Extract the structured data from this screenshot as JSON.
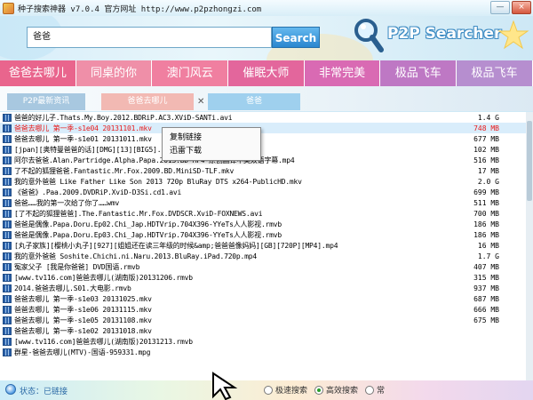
{
  "window": {
    "title": "种子搜索神器  v7.0.4  官方网址  http://www.p2pzhongzi.com",
    "minimize_glyph": "—",
    "close_glyph": "×"
  },
  "search": {
    "query": "爸爸",
    "button_label": "Search"
  },
  "logo": {
    "text": "P2P Searcher"
  },
  "hot_tags": [
    {
      "label": "爸爸去哪儿",
      "color": "#e9658d"
    },
    {
      "label": "同桌的你",
      "color": "#ef8fa8"
    },
    {
      "label": "澳门风云",
      "color": "#f07fa0"
    },
    {
      "label": "催眠大师",
      "color": "#e3669c"
    },
    {
      "label": "非常完美",
      "color": "#d96ab3"
    },
    {
      "label": "极品飞车",
      "color": "#be78c4"
    },
    {
      "label": "极品飞车",
      "color": "#b68ecf"
    }
  ],
  "tabs": [
    {
      "label": "P2P最新资讯",
      "color": "#a8c8e0"
    },
    {
      "label": "爸爸去哪儿",
      "color": "#f2b9b3"
    },
    {
      "label": "爸爸",
      "color": "#9fd0ee"
    }
  ],
  "tab_close_glyph": "✕",
  "files": [
    {
      "name": "爸爸的好儿子.Thats.My.Boy.2012.BDRiP.AC3.XViD-SANTi.avi",
      "size": "1.4 G"
    },
    {
      "name": "爸爸去哪儿 第一季-s1e04 20131101.mkv",
      "size": "748 MB"
    },
    {
      "name": "爸爸去哪儿 第一季-s1e01 20131011.mkv",
      "size": "677 MB"
    },
    {
      "name": "[jpan][奥特曼爸爸的话][DMG][13][BIG5].rmvb",
      "size": "102 MB"
    },
    {
      "name": "阿尔去爸爸.Alan.Partridge.Alpha.Papa.2013.BD-MP4-原创翻译中英双语字幕.mp4",
      "size": "516 MB"
    },
    {
      "name": "了不起的狐狸爸爸.Fantastic.Mr.Fox.2009.BD.MiniSD-TLF.mkv",
      "size": "17 MB"
    },
    {
      "name": "我的意外爸爸 Like Father Like Son 2013 720p BluRay DTS x264-PublicHD.mkv",
      "size": "2.0 G"
    },
    {
      "name": "《爸爸》.Paa.2009.DVDRiP.XviD-D3Si.cd1.avi",
      "size": "699 MB"
    },
    {
      "name": "爸爸……我的第一次给了你了……wmv",
      "size": "511 MB"
    },
    {
      "name": "[了不起的狐狸爸爸].The.Fantastic.Mr.Fox.DVDSCR.XviD-FOXNEWS.avi",
      "size": "700 MB"
    },
    {
      "name": "爸爸是偶像.Papa.Doru.Ep02.Chi_Jap.HDTVrip.704X396-YYeTs人人影视.rmvb",
      "size": "186 MB"
    },
    {
      "name": "爸爸是偶像.Papa.Doru.Ep03.Chi_Jap.HDTVrip.704X396-YYeTs人人影视.rmvb",
      "size": "186 MB"
    },
    {
      "name": "[丸子家族][樱桃小丸子][927][姐姐还在读三年级的时候&amp;爸爸爸像妈妈][GB][720P][MP4].mp4",
      "size": "16 MB"
    },
    {
      "name": "我的意外爸爸  Soshite.Chichi.ni.Naru.2013.BluRay.iPad.720p.mp4",
      "size": "1.7 G"
    },
    {
      "name": "冤家父子 [我是你爸爸]  DVD国语.rmvb",
      "size": "407 MB"
    },
    {
      "name": "[www.tv116.com]爸爸去哪儿(湖南版)20131206.rmvb",
      "size": "315 MB"
    },
    {
      "name": "2014.爸爸去哪儿.S01.大电影.rmvb",
      "size": "937 MB"
    },
    {
      "name": "爸爸去哪儿 第一季-s1e03 20131025.mkv",
      "size": "687 MB"
    },
    {
      "name": "爸爸去哪儿 第一季-s1e06 20131115.mkv",
      "size": "666 MB"
    },
    {
      "name": "爸爸去哪儿 第一季-s1e05 20131108.mkv",
      "size": "675 MB"
    },
    {
      "name": "爸爸去哪儿 第一季-s1e02 20131018.mkv",
      "size": ""
    },
    {
      "name": "[www.tv116.com]爸爸去哪儿(湖南版)20131213.rmvb",
      "size": ""
    },
    {
      "name": "群星-爸爸去哪儿(MTV)-国语-959331.mpg",
      "size": ""
    }
  ],
  "context_menu": {
    "items": [
      "复制链接",
      "迅雷下载"
    ]
  },
  "status": {
    "text": "状态：已链接",
    "options": [
      {
        "label": "极速搜索",
        "checked": false
      },
      {
        "label": "高效搜索",
        "checked": true
      },
      {
        "label": "常",
        "checked": false
      }
    ]
  }
}
